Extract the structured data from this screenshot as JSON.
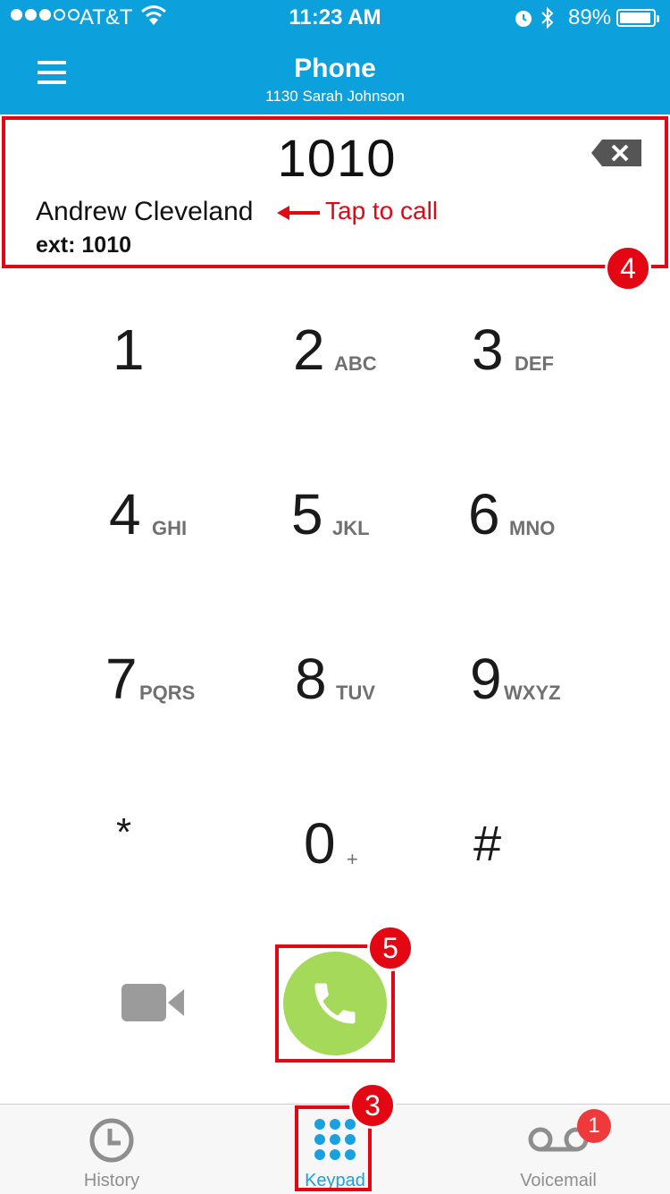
{
  "status_bar": {
    "carrier": "AT&T",
    "time": "11:23 AM",
    "battery": "89%"
  },
  "header": {
    "title": "Phone",
    "subtitle": "1130 Sarah Johnson"
  },
  "dialer": {
    "number": "1010",
    "contact_name": "Andrew Cleveland",
    "contact_ext": "ext: 1010",
    "hint": "Tap to call"
  },
  "keypad": [
    {
      "digit": "1",
      "letters": ""
    },
    {
      "digit": "2",
      "letters": "ABC"
    },
    {
      "digit": "3",
      "letters": "DEF"
    },
    {
      "digit": "4",
      "letters": "GHI"
    },
    {
      "digit": "5",
      "letters": "JKL"
    },
    {
      "digit": "6",
      "letters": "MNO"
    },
    {
      "digit": "7",
      "letters": "PQRS"
    },
    {
      "digit": "8",
      "letters": "TUV"
    },
    {
      "digit": "9",
      "letters": "WXYZ"
    },
    {
      "digit": "*",
      "letters": ""
    },
    {
      "digit": "0",
      "letters": "+"
    },
    {
      "digit": "#",
      "letters": ""
    }
  ],
  "callouts": {
    "step_3": "3",
    "step_4": "4",
    "step_5": "5"
  },
  "tabs": {
    "history": "History",
    "keypad": "Keypad",
    "voicemail": "Voicemail",
    "voicemail_badge": "1"
  },
  "colors": {
    "header_bg": "#0ca0dc",
    "accent_red": "#e30613",
    "call_green": "#a4d95a",
    "tab_active": "#1aa0dd"
  }
}
